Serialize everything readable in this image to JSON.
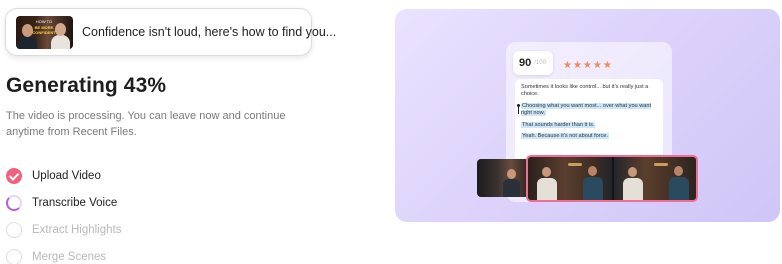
{
  "video": {
    "title": "Confidence isn't loud, here's how to find you...",
    "thumbnail_line1": "HOW TO",
    "thumbnail_line2": "BE MORE CONFIDENT"
  },
  "status": {
    "title": "Generating 43%",
    "progress_percent": 43,
    "description": "The video is processing. You can leave now and continue anytime from Recent Files."
  },
  "steps": [
    {
      "label": "Upload Video",
      "state": "done"
    },
    {
      "label": "Transcribe Voice",
      "state": "active"
    },
    {
      "label": "Extract Highlights",
      "state": "pending"
    },
    {
      "label": "Merge Scenes",
      "state": "pending"
    }
  ],
  "illustration": {
    "score": "90",
    "score_suffix": "/100",
    "stars": "★★★★★",
    "transcript": [
      "Sometimes it looks like control... but it's really just a choice.",
      "Choosing what you want most... over what you want right now.",
      "That sounds harder than it is.",
      "Yeah. Because it's not about force."
    ]
  },
  "colors": {
    "accent_pink": "#f0617c",
    "accent_purple": "#b95ce0",
    "panel_bg": "#ddd3fb"
  }
}
